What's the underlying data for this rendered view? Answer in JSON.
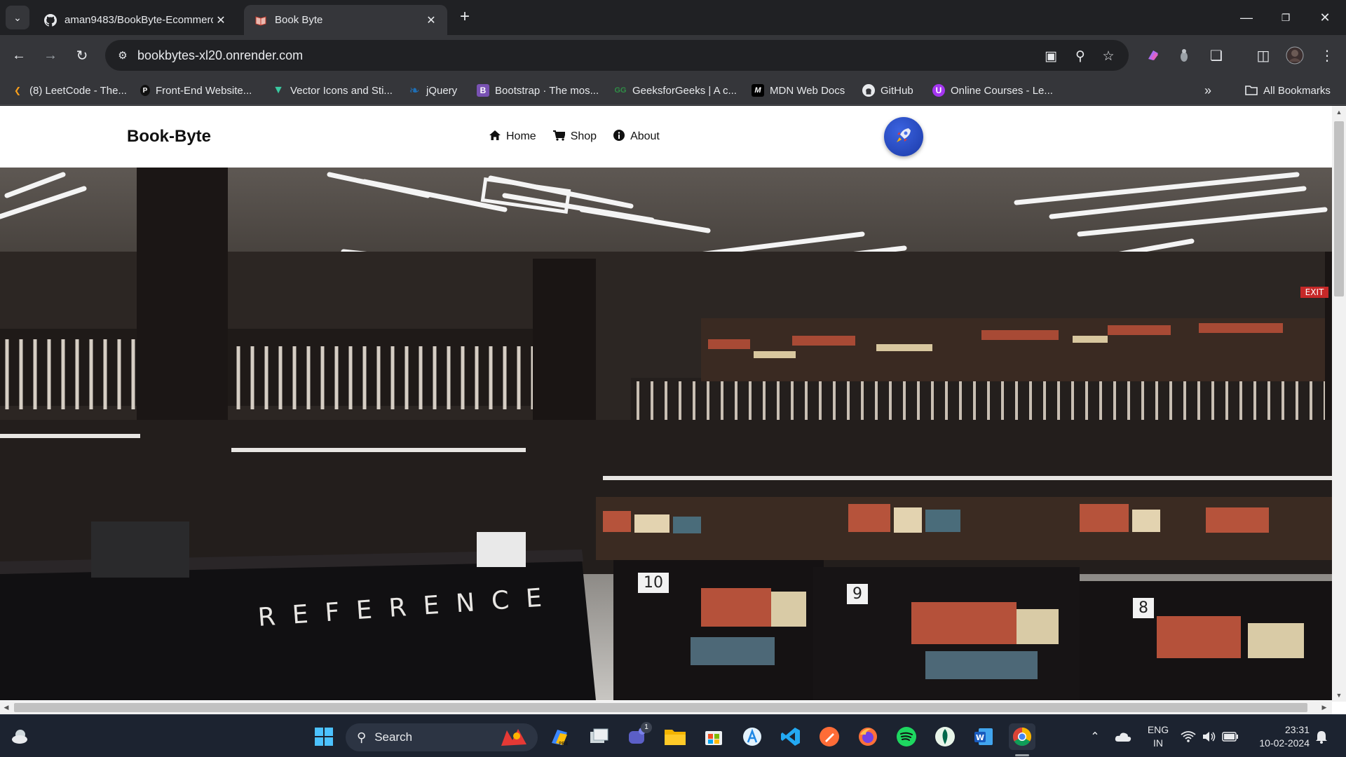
{
  "browser": {
    "tabs": [
      {
        "title": "aman9483/BookByte-Ecommerce",
        "icon": "github-icon",
        "active": false
      },
      {
        "title": "Book Byte",
        "icon": "book-icon",
        "active": true
      }
    ],
    "url": "bookbytes-xl20.onrender.com",
    "bookmarks": [
      {
        "label": "(8) LeetCode - The...",
        "icon": "leetcode-icon",
        "color": "#f89f1b"
      },
      {
        "label": "Front-End Website...",
        "icon": "frontend-icon",
        "color": "#111111"
      },
      {
        "label": "Vector Icons and Sti...",
        "icon": "flaticon-icon",
        "color": "#3ac9a0"
      },
      {
        "label": "jQuery",
        "icon": "jquery-icon",
        "color": "#1f6fb5"
      },
      {
        "label": "Bootstrap · The mos...",
        "icon": "bootstrap-icon",
        "color": "#7952b3"
      },
      {
        "label": "GeeksforGeeks | A c...",
        "icon": "gfg-icon",
        "color": "#2f8d46"
      },
      {
        "label": "MDN Web Docs",
        "icon": "mdn-icon",
        "color": "#000000"
      },
      {
        "label": "GitHub",
        "icon": "github-icon",
        "color": "#ffffff"
      },
      {
        "label": "Online Courses - Le...",
        "icon": "udemy-icon",
        "color": "#a435f0"
      }
    ],
    "all_bookmarks_label": "All Bookmarks"
  },
  "site": {
    "brand": "Book-Byte",
    "nav": [
      {
        "label": "Home",
        "icon": "home-icon"
      },
      {
        "label": "Shop",
        "icon": "cart-icon"
      },
      {
        "label": "About",
        "icon": "info-icon"
      }
    ],
    "hero": {
      "reference_sign": "REFERENCE",
      "shelf_numbers": [
        "10",
        "9",
        "8"
      ],
      "exit_sign": "EXIT"
    }
  },
  "taskbar": {
    "search_label": "Search",
    "language": [
      "ENG",
      "IN"
    ],
    "time": "23:31",
    "date": "10-02-2024",
    "teams_badge": "1"
  }
}
